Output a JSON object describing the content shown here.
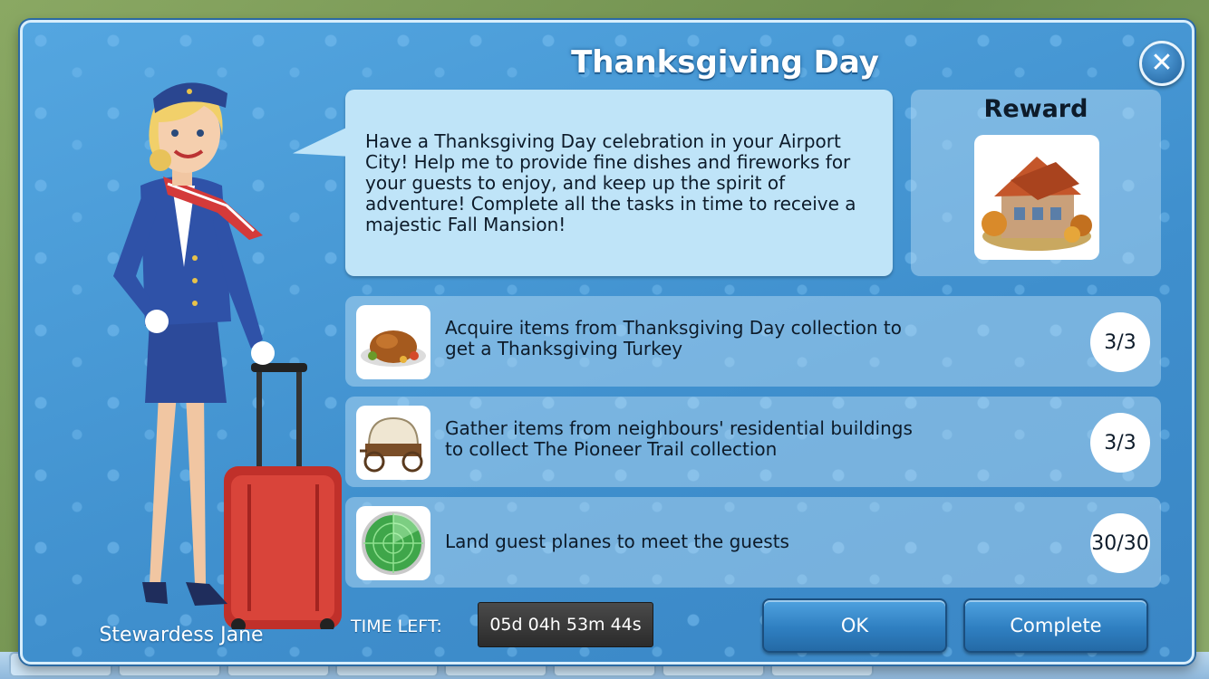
{
  "dialog": {
    "title": "Thanksgiving Day",
    "close_icon": "close-icon"
  },
  "npc": {
    "name": "Stewardess Jane"
  },
  "bubble": {
    "text": "Have a Thanksgiving Day celebration in your Airport City! Help me to provide fine dishes and fireworks for your guests to enjoy, and keep up the spirit of adventure! Complete all the tasks in time to receive a majestic Fall Mansion!"
  },
  "reward": {
    "title": "Reward",
    "icon": "fall-mansion-icon"
  },
  "tasks": [
    {
      "icon": "roast-turkey-icon",
      "text": "Acquire items from Thanksgiving Day collection to get a Thanksgiving Turkey",
      "progress": "3/3"
    },
    {
      "icon": "covered-wagon-icon",
      "text": "Gather items from neighbours' residential buildings to collect The Pioneer Trail collection",
      "progress": "3/3"
    },
    {
      "icon": "radar-icon",
      "text": "Land guest planes to meet the guests",
      "progress": "30/30"
    }
  ],
  "timer": {
    "label": "TIME LEFT:",
    "value": "05d 04h 53m 44s"
  },
  "buttons": {
    "ok": "OK",
    "complete": "Complete"
  },
  "colors": {
    "panel_blue": "#4a9ad6",
    "bubble": "#bfe4f8",
    "button_blue": "#2f7fc1"
  }
}
